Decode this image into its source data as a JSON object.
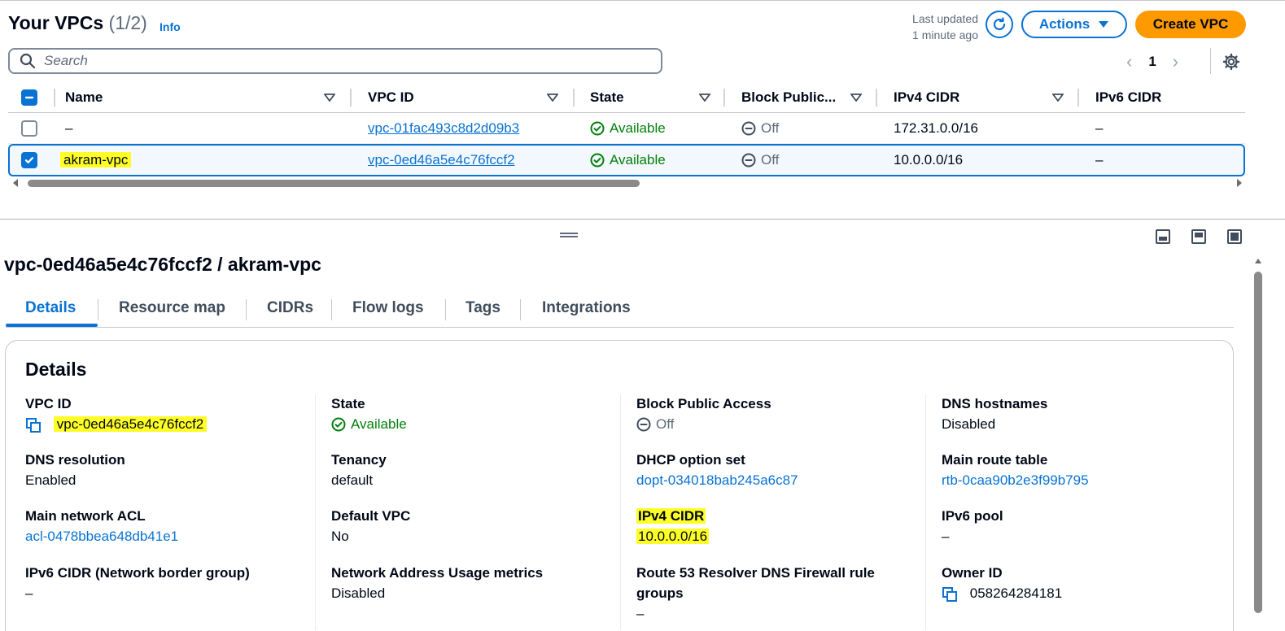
{
  "header": {
    "title": "Your VPCs",
    "count": "(1/2)",
    "info": "Info",
    "last_updated_line1": "Last updated",
    "last_updated_line2": "1 minute ago",
    "actions_label": "Actions",
    "create_label": "Create VPC"
  },
  "search": {
    "placeholder": "Search"
  },
  "pager": {
    "page": "1"
  },
  "table": {
    "columns": [
      "Name",
      "VPC ID",
      "State",
      "Block Public...",
      "IPv4 CIDR",
      "IPv6 CIDR"
    ],
    "rows": [
      {
        "name": "–",
        "vpc_id": "vpc-01fac493c8d2d09b3",
        "state": "Available",
        "block": "Off",
        "ipv4": "172.31.0.0/16",
        "ipv6": "–",
        "selected": false
      },
      {
        "name": "akram-vpc",
        "vpc_id": "vpc-0ed46a5e4c76fccf2",
        "state": "Available",
        "block": "Off",
        "ipv4": "10.0.0.0/16",
        "ipv6": "–",
        "selected": true
      }
    ]
  },
  "detail": {
    "title": "vpc-0ed46a5e4c76fccf2 / akram-vpc",
    "tabs": [
      "Details",
      "Resource map",
      "CIDRs",
      "Flow logs",
      "Tags",
      "Integrations"
    ],
    "section_title": "Details",
    "fields": {
      "vpc_id": {
        "label": "VPC ID",
        "value": "vpc-0ed46a5e4c76fccf2"
      },
      "state": {
        "label": "State",
        "value": "Available"
      },
      "block_public_access": {
        "label": "Block Public Access",
        "value": "Off"
      },
      "dns_hostnames": {
        "label": "DNS hostnames",
        "value": "Disabled"
      },
      "dns_resolution": {
        "label": "DNS resolution",
        "value": "Enabled"
      },
      "tenancy": {
        "label": "Tenancy",
        "value": "default"
      },
      "dhcp": {
        "label": "DHCP option set",
        "value": "dopt-034018bab245a6c87"
      },
      "main_route_table": {
        "label": "Main route table",
        "value": "rtb-0caa90b2e3f99b795"
      },
      "main_acl": {
        "label": "Main network ACL",
        "value": "acl-0478bbea648db41e1"
      },
      "default_vpc": {
        "label": "Default VPC",
        "value": "No"
      },
      "ipv4_cidr": {
        "label": "IPv4 CIDR",
        "value": "10.0.0.0/16"
      },
      "ipv6_pool": {
        "label": "IPv6 pool",
        "value": "–"
      },
      "ipv6_cidr": {
        "label": "IPv6 CIDR (Network border group)",
        "value": "–"
      },
      "nau_metrics": {
        "label": "Network Address Usage metrics",
        "value": "Disabled"
      },
      "route53": {
        "label_line1": "Route 53 Resolver DNS Firewall rule",
        "label_line2": "groups",
        "value": "–"
      },
      "owner_id": {
        "label": "Owner ID",
        "value": "058264284181"
      }
    }
  },
  "colors": {
    "accent": "#0972d3",
    "primary": "#ff9900",
    "success": "#037f0c",
    "highlight": "#ffff26"
  }
}
